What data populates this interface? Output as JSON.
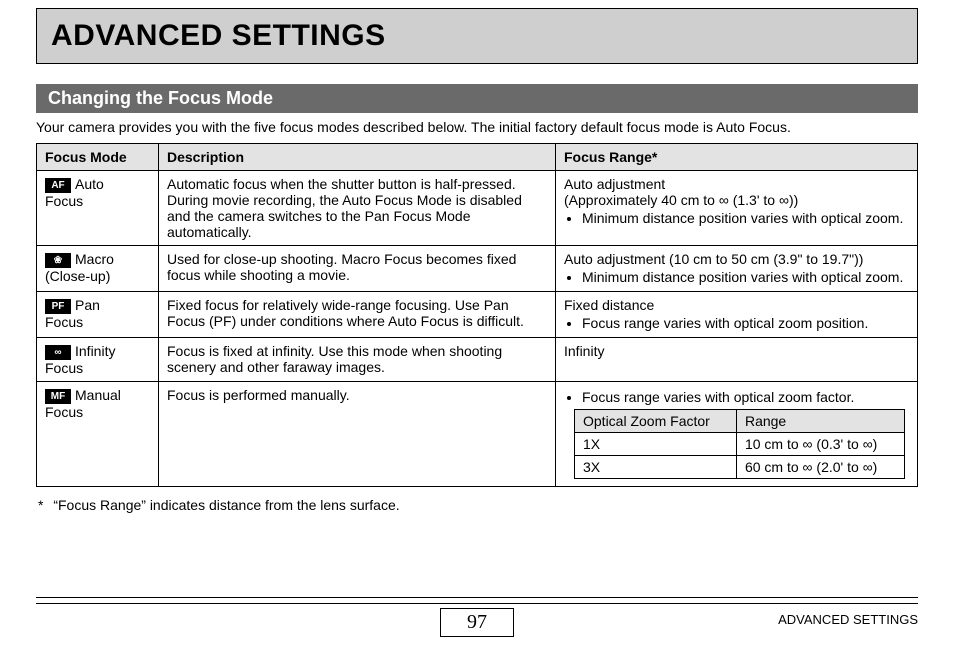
{
  "title": "ADVANCED SETTINGS",
  "section": "Changing the Focus Mode",
  "intro": "Your camera provides you with the five focus modes described below. The initial factory default focus mode is Auto Focus.",
  "headers": {
    "mode": "Focus Mode",
    "desc": "Description",
    "range": "Focus Range",
    "range_marker": "*"
  },
  "rows": [
    {
      "icon": "AF",
      "name_l1": "Auto",
      "name_l2": "Focus",
      "desc": "Automatic focus when the shutter button is half-pressed. During movie recording, the Auto Focus Mode is disabled and the camera switches to the Pan Focus Mode automatically.",
      "range_lead_l1": "Auto adjustment",
      "range_lead_l2a": "(Approximately 40 cm to ",
      "range_lead_l2b": " (1.3' to ",
      "range_lead_l2c": "))",
      "range_bullet": "Minimum distance position varies with optical zoom."
    },
    {
      "icon": "❀",
      "name_l1": "Macro",
      "name_l2": "(Close-up)",
      "desc": "Used for close-up shooting. Macro Focus becomes fixed focus while shooting a movie.",
      "range_lead": "Auto adjustment (10 cm to 50 cm (3.9\" to 19.7\"))",
      "range_bullet": "Minimum distance position varies with optical zoom."
    },
    {
      "icon": "PF",
      "name_l1": "Pan",
      "name_l2": "Focus",
      "desc": "Fixed focus for relatively wide-range focusing. Use Pan Focus (PF) under conditions where Auto Focus is difficult.",
      "range_lead": "Fixed distance",
      "range_bullet": "Focus range varies with optical zoom position."
    },
    {
      "icon": "∞",
      "name_l1": "Infinity",
      "name_l2": "Focus",
      "desc": "Focus is fixed at infinity. Use this mode when shooting scenery and other faraway images.",
      "range_lead": "Infinity"
    },
    {
      "icon": "MF",
      "name_l1": "Manual",
      "name_l2": "Focus",
      "desc": "Focus is performed manually.",
      "range_bullet": "Focus range varies with optical zoom factor.",
      "zoom": {
        "h1": "Optical Zoom Factor",
        "h2": "Range",
        "r1c1": "1X",
        "r1c2a": "10 cm to ",
        "r1c2b": " (0.3' to ",
        "r1c2c": ")",
        "r2c1": "3X",
        "r2c2a": "60 cm to ",
        "r2c2b": " (2.0' to ",
        "r2c2c": ")"
      }
    }
  ],
  "footnote": "“Focus Range” indicates distance from the lens surface.",
  "footnote_marker": "*",
  "page_number": "97",
  "footer_title": "ADVANCED SETTINGS",
  "inf": "∞"
}
